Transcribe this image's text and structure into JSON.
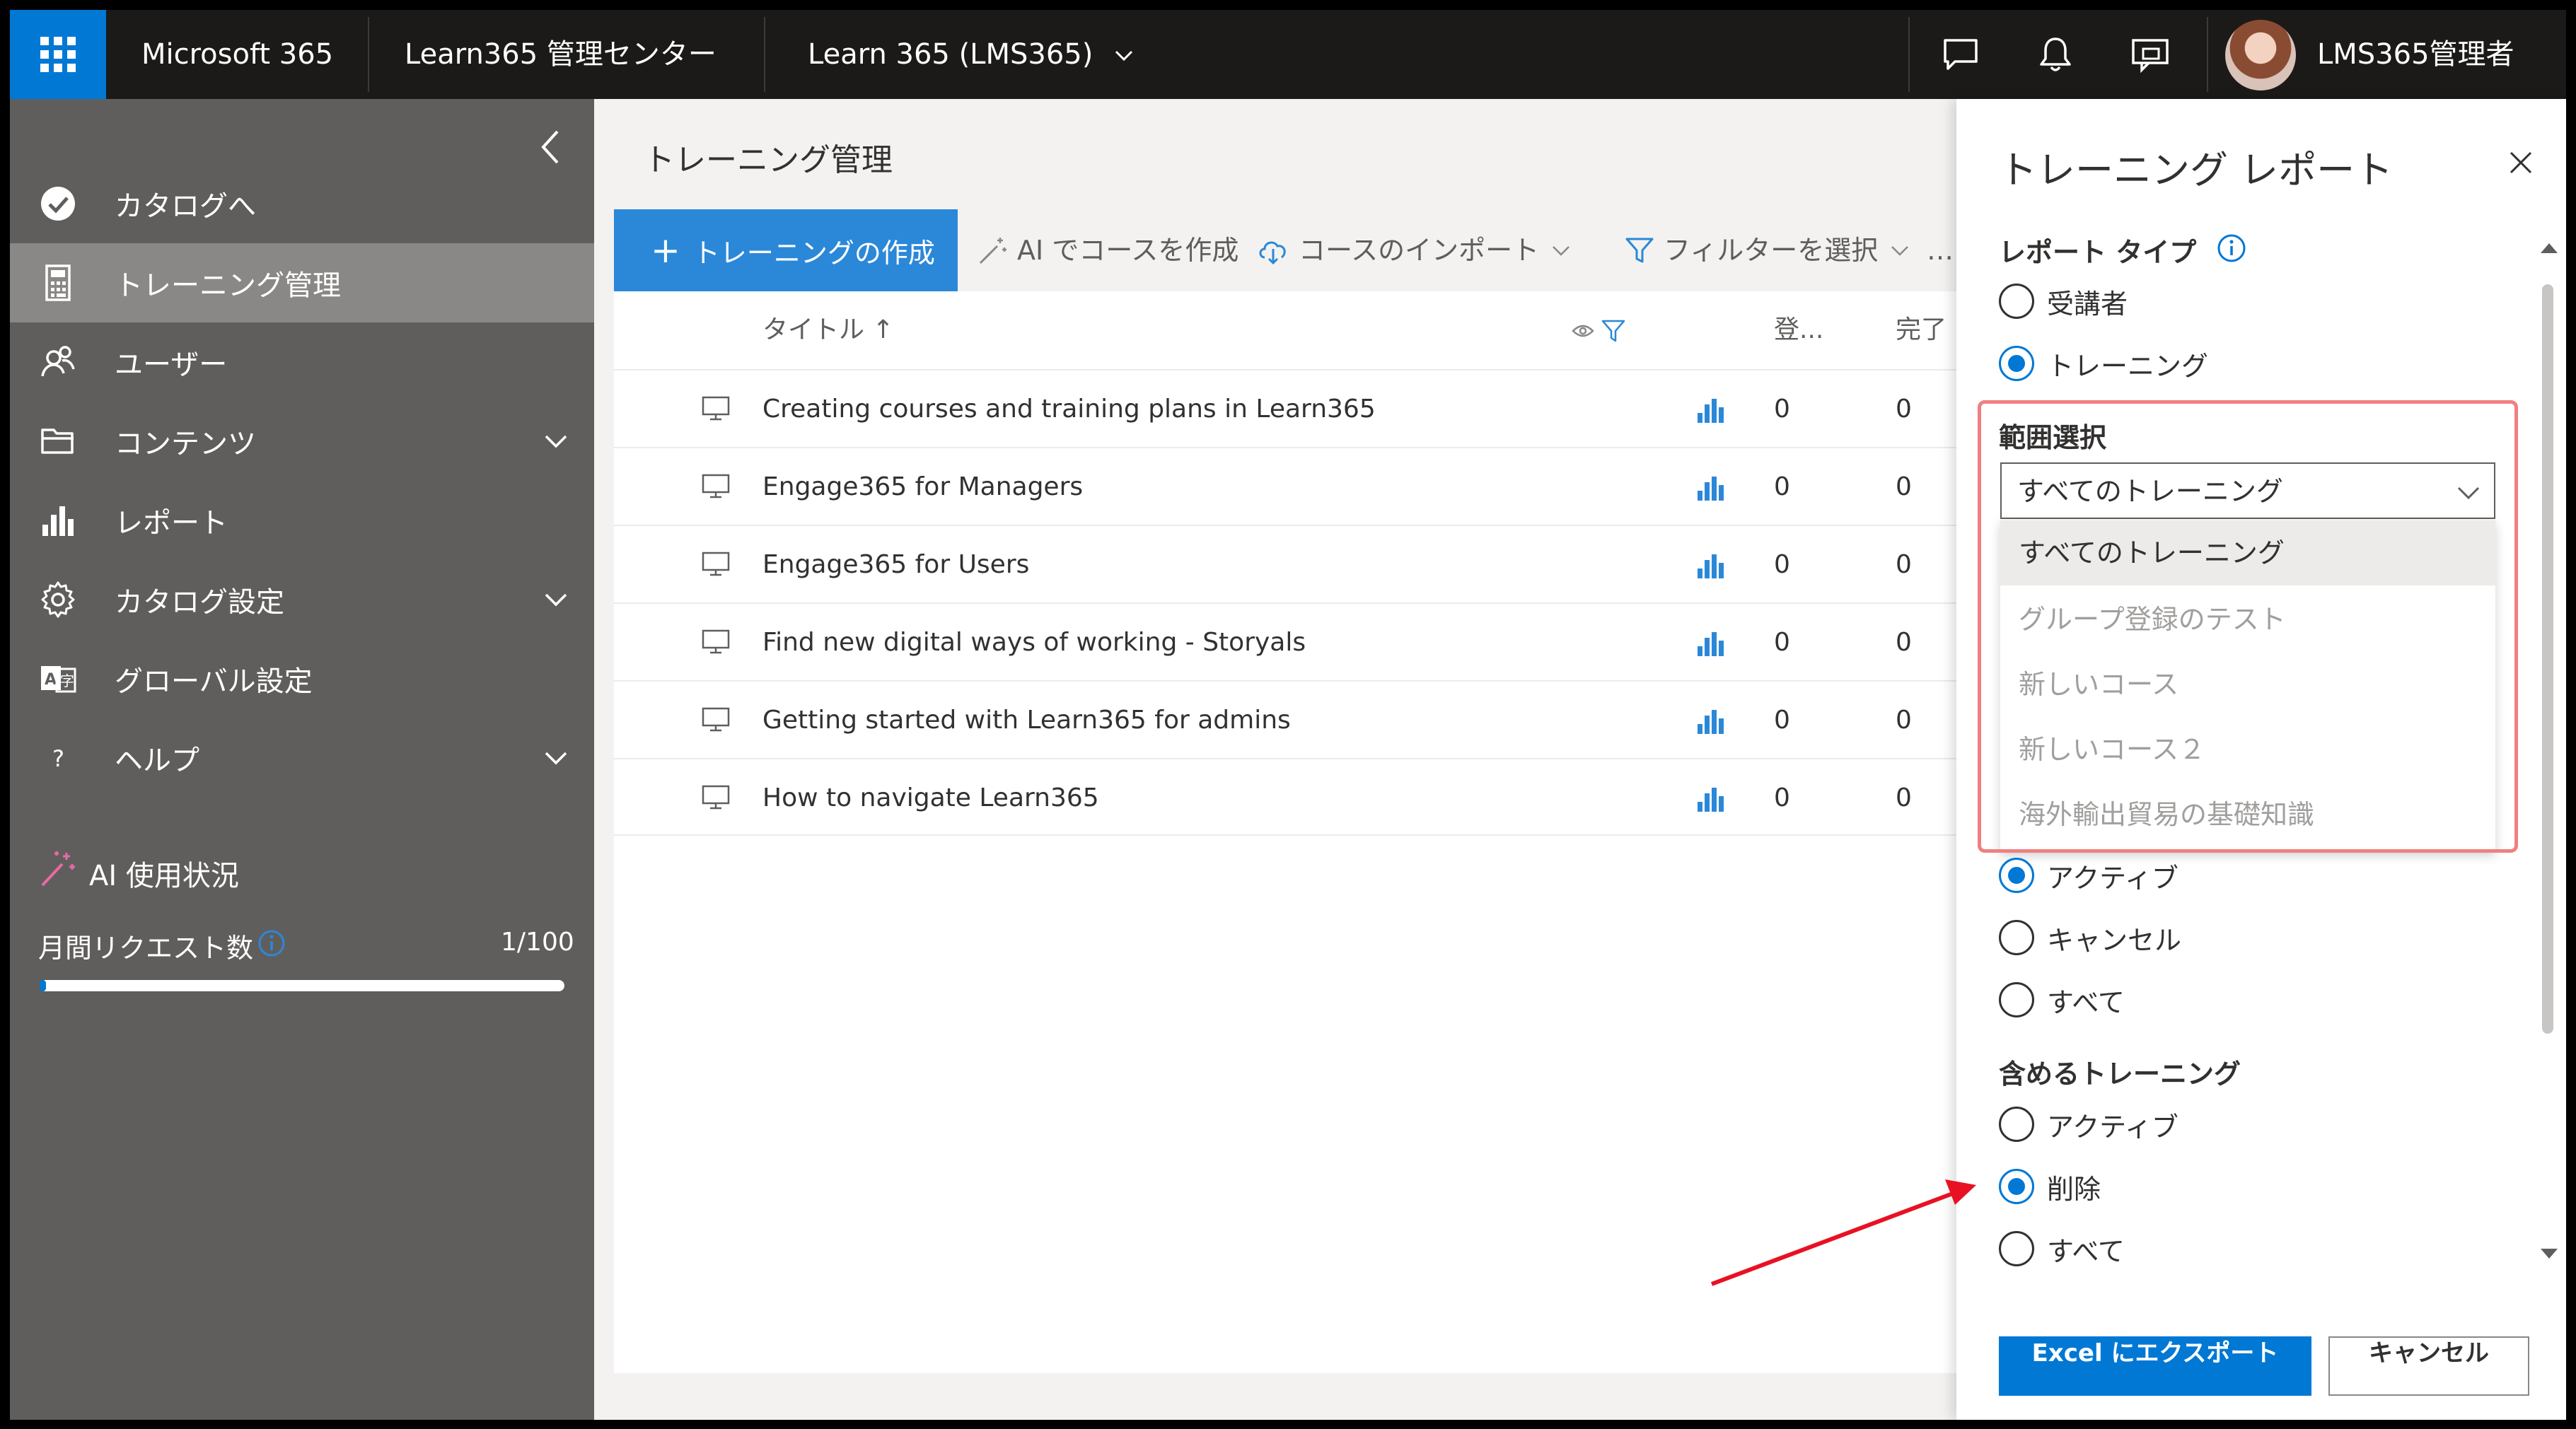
{
  "topbar": {
    "app_name": "Microsoft 365",
    "admin_center": "Learn365 管理センター",
    "tenant": "Learn 365 (LMS365)",
    "user_name": "LMS365管理者"
  },
  "sidebar": {
    "items": [
      {
        "label": "カタログへ",
        "icon": "check-circle-icon"
      },
      {
        "label": "トレーニング管理",
        "icon": "calculator-icon",
        "selected": true
      },
      {
        "label": "ユーザー",
        "icon": "users-icon"
      },
      {
        "label": "コンテンツ",
        "icon": "folder-icon",
        "expandable": true
      },
      {
        "label": "レポート",
        "icon": "bar-chart-icon"
      },
      {
        "label": "カタログ設定",
        "icon": "gear-icon",
        "expandable": true
      },
      {
        "label": "グローバル設定",
        "icon": "translate-icon"
      },
      {
        "label": "ヘルプ",
        "icon": "help-icon",
        "expandable": true
      }
    ],
    "ai_usage": {
      "title": "AI 使用状況",
      "monthly_requests_label": "月間リクエスト数",
      "monthly_requests_value": "1/100",
      "used": 1,
      "limit": 100
    }
  },
  "main": {
    "title": "トレーニング管理",
    "commands": {
      "create": "トレーニングの作成",
      "ai_create": "AI でコースを作成",
      "import": "コースのインポート",
      "filter": "フィルターを選択",
      "more": "…"
    },
    "columns": {
      "title": "タイトル ↑",
      "enrolled": "登...",
      "completed": "完了"
    },
    "rows": [
      {
        "title": "Creating courses and training plans in Learn365",
        "enrolled": "0",
        "completed": "0"
      },
      {
        "title": "Engage365 for Managers",
        "enrolled": "0",
        "completed": "0"
      },
      {
        "title": "Engage365 for Users",
        "enrolled": "0",
        "completed": "0"
      },
      {
        "title": "Find new digital ways of working - Storyals",
        "enrolled": "0",
        "completed": "0"
      },
      {
        "title": "Getting started with Learn365 for admins",
        "enrolled": "0",
        "completed": "0"
      },
      {
        "title": "How to navigate Learn365",
        "enrolled": "0",
        "completed": "0"
      }
    ]
  },
  "panel": {
    "title": "トレーニング レポート",
    "report_type_label": "レポート タイプ",
    "report_type_options": [
      "受講者",
      "トレーニング"
    ],
    "report_type_selected": "トレーニング",
    "scope_label": "範囲選択",
    "scope_value": "すべてのトレーニング",
    "scope_options": [
      "すべてのトレーニング",
      "グループ登録のテスト",
      "新しいコース",
      "新しいコース２",
      "海外輸出貿易の基礎知識"
    ],
    "status_options": [
      "アクティブ",
      "キャンセル",
      "すべて"
    ],
    "status_selected": "アクティブ",
    "include_label": "含めるトレーニング",
    "include_options": [
      "アクティブ",
      "削除",
      "すべて"
    ],
    "include_selected": "削除",
    "export_button": "Excel にエクスポート",
    "cancel_button": "キャンセル"
  },
  "colors": {
    "accent": "#0078d4",
    "topbar": "#1b1a19",
    "sidebar": "#605e5c",
    "highlight": "#f08080",
    "arrow": "#e81123"
  }
}
